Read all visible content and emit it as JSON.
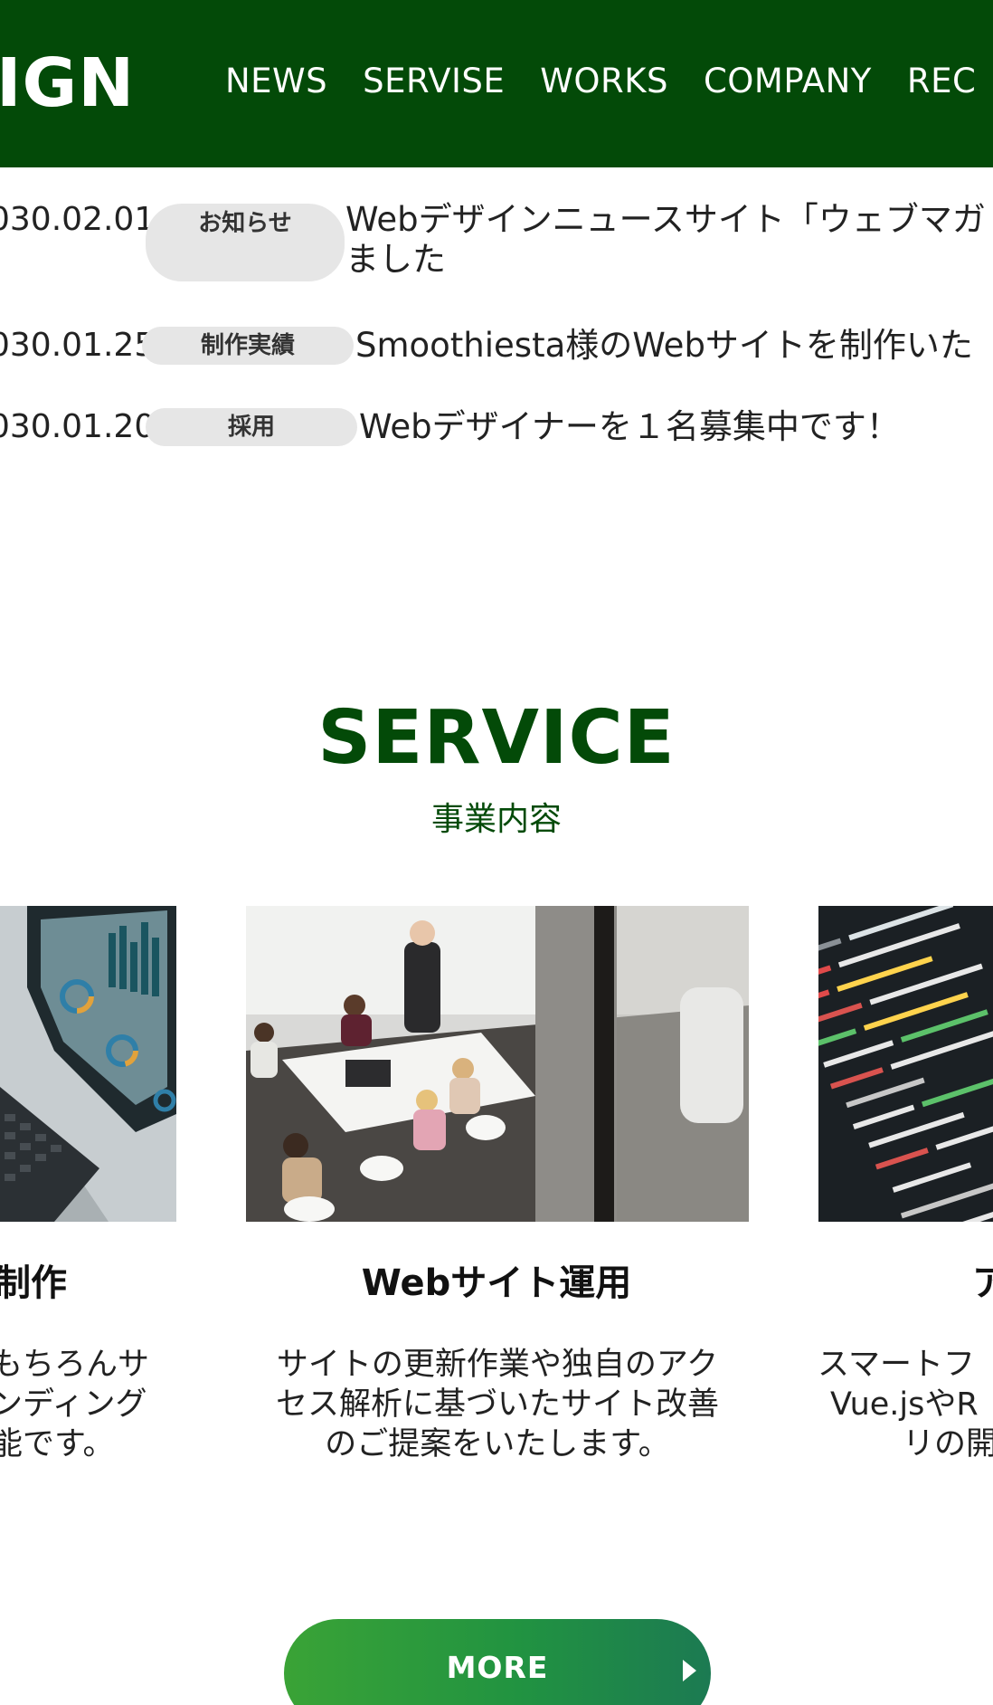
{
  "header": {
    "logo_text": "IGN",
    "nav": [
      "NEWS",
      "SERVISE",
      "WORKS",
      "COMPANY",
      "REC"
    ]
  },
  "news": [
    {
      "date": "030.02.01",
      "category": "お知らせ",
      "title_line1": "Webデザインニュースサイト「ウェブマガ",
      "title_line2": "ました"
    },
    {
      "date": "030.01.25",
      "category": "制作実績",
      "title_line1": "Smoothiesta様のWebサイトを制作いた"
    },
    {
      "date": "030.01.20",
      "category": "採用",
      "title_line1": "Webデザイナーを１名募集中です！"
    }
  ],
  "service": {
    "title": "SERVICE",
    "subtitle": "事業内容",
    "cards": [
      {
        "title": "制作",
        "desc": [
          "もちろんサ",
          "ンディング",
          "能です。"
        ]
      },
      {
        "title": "Webサイト運用",
        "desc": [
          "サイトの更新作業や独自のアク",
          "セス解析に基づいたサイト改善",
          "のご提案をいたします。"
        ]
      },
      {
        "title": "ア",
        "desc": [
          "スマートフ",
          "Vue.jsやR",
          "リの開"
        ]
      }
    ]
  },
  "more_button": {
    "label": "MORE"
  },
  "colors": {
    "brand_green": "#034a08",
    "tag_bg": "#e6e6e6",
    "button_start": "#3aa336",
    "button_end": "#1c7a52"
  }
}
